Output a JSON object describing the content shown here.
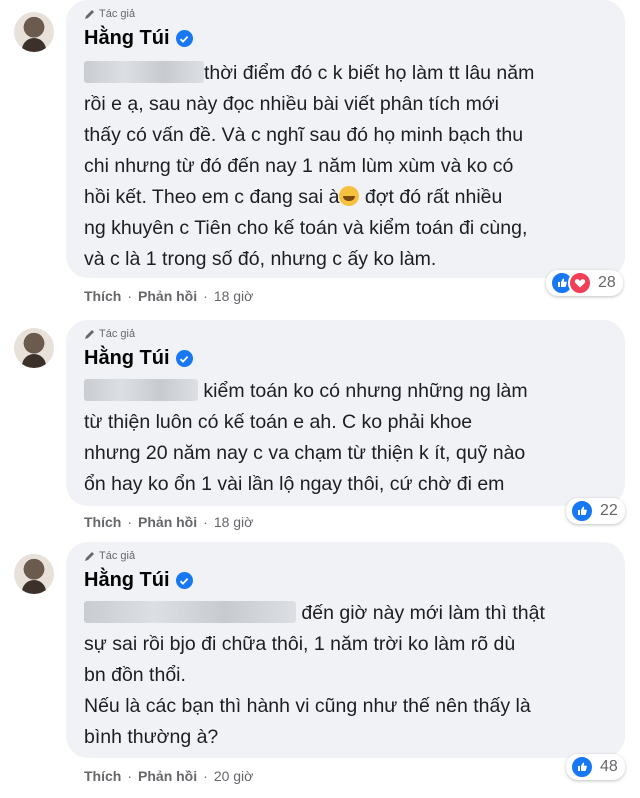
{
  "comments": [
    {
      "badge": "Tác giả",
      "author": "Hằng Túi",
      "lines": [
        "thời điểm đó c k biết họ làm tt lâu năm",
        "rồi e ạ, sau này đọc nhiều bài viết phân tích mới",
        "thấy có vấn đề. Và c nghĩ sau đó họ minh bạch thu",
        "chi nhưng từ đó đến nay 1 năm lùm xùm và ko có",
        "hồi kết. Theo em c đang sai à",
        " đợt đó rất nhiều",
        "ng khuyên c Tiên cho kế toán và kiểm toán đi cùng,",
        "và c là 1 trong số đó, nhưng c ấy ko làm."
      ],
      "like_label": "Thích",
      "reply_label": "Phản hồi",
      "time": "18 giờ",
      "reaction_count": "28",
      "reaction_icons": [
        "like-icon",
        "love-icon"
      ]
    },
    {
      "badge": "Tác giả",
      "author": "Hằng Túi",
      "lines": [
        "kiểm toán ko có nhưng những ng làm",
        "từ thiện luôn có kế toán e ah. C ko phải khoe",
        "nhưng 20 năm nay c va chạm từ thiện k ít, quỹ nào",
        "ổn hay ko ổn 1 vài lần lộ ngay thôi, cứ chờ đi em"
      ],
      "like_label": "Thích",
      "reply_label": "Phản hồi",
      "time": "18 giờ",
      "reaction_count": "22",
      "reaction_icons": [
        "like-icon"
      ]
    },
    {
      "badge": "Tác giả",
      "author": "Hằng Túi",
      "lines": [
        "đến giờ này mới làm thì thật",
        "sự sai rồi bjo đi chữa thôi, 1 năm trời ko làm rõ dù",
        "bn đồn thổi.",
        "Nếu là các bạn thì hành vi cũng như thế nên thấy là",
        "bình thường à?"
      ],
      "like_label": "Thích",
      "reply_label": "Phản hồi",
      "time": "20 giờ",
      "reaction_count": "48",
      "reaction_icons": [
        "like-icon"
      ]
    }
  ],
  "colors": {
    "bubble": "#f0f2f5",
    "like": "#1877f2",
    "love": "#f33e58",
    "meta": "#65676b"
  }
}
